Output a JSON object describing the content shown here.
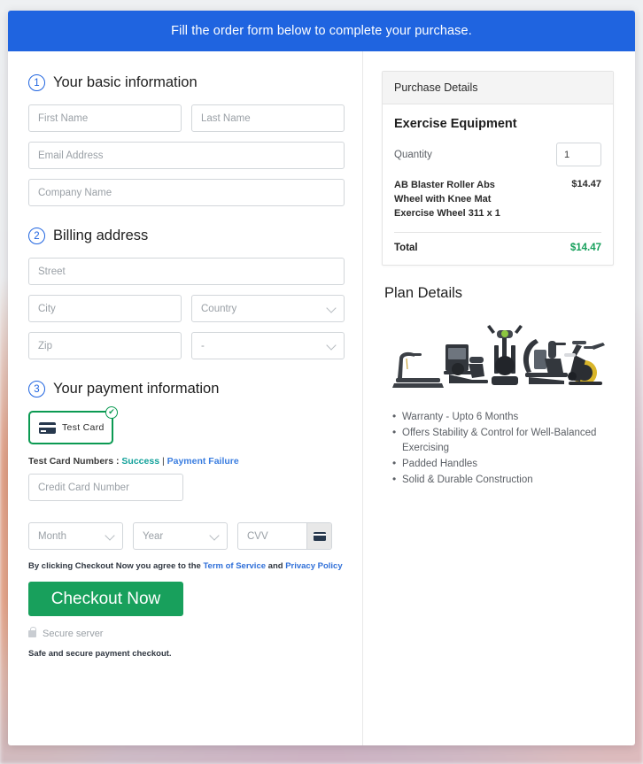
{
  "banner": {
    "message": "Fill the order form below to complete your purchase."
  },
  "steps": [
    {
      "num": "1",
      "title": "Your basic information"
    },
    {
      "num": "2",
      "title": "Billing address"
    },
    {
      "num": "3",
      "title": "Your payment information"
    }
  ],
  "basic_info": {
    "first_name_placeholder": "First Name",
    "last_name_placeholder": "Last Name",
    "email_placeholder": "Email Address",
    "company_placeholder": "Company Name"
  },
  "billing": {
    "street_placeholder": "Street",
    "city_placeholder": "City",
    "country_placeholder": "Country",
    "zip_placeholder": "Zip",
    "state_placeholder": "-"
  },
  "payment": {
    "test_card_label": "Test  Card",
    "card_icon": "credit-card-icon",
    "selected_badge": "check-circle-icon",
    "check_glyph": "✔",
    "test_numbers_prefix": "Test Card Numbers : ",
    "success_link": "Success",
    "separator": " | ",
    "failure_link": "Payment Failure",
    "card_number_placeholder": "Credit Card Number",
    "month_placeholder": "Month",
    "year_placeholder": "Year",
    "cvv_placeholder": "CVV",
    "cvv_icon": "credit-card-icon"
  },
  "agreement": {
    "prefix": "By clicking Checkout Now you agree to the ",
    "terms_link": "Term of Service",
    "middle": " and ",
    "privacy_link": "Privacy Policy"
  },
  "checkout": {
    "button_label": "Checkout Now",
    "secure_icon": "lock-icon",
    "secure_label": "Secure server",
    "safe_note": "Safe and secure payment checkout."
  },
  "purchase_details": {
    "header": "Purchase Details",
    "product_title": "Exercise Equipment",
    "quantity_label": "Quantity",
    "quantity_value": "1",
    "line_item_description": "AB Blaster Roller Abs Wheel with Knee Mat Exercise Wheel 311 x 1",
    "line_item_price": "$14.47",
    "total_label": "Total",
    "total_value": "$14.47"
  },
  "plan_details": {
    "title": "Plan Details",
    "image_alt": "exercise-equipment-lineup",
    "features": [
      "Warranty - Upto 6 Months",
      "Offers Stability & Control for Well-Balanced Exercising",
      "Padded Handles",
      "Solid & Durable Construction"
    ]
  },
  "colors": {
    "banner_blue": "#1f64e0",
    "accent_green": "#18a05c",
    "total_green": "#17a05c",
    "link_blue": "#2f6fd8",
    "success_teal": "#12a19a"
  }
}
